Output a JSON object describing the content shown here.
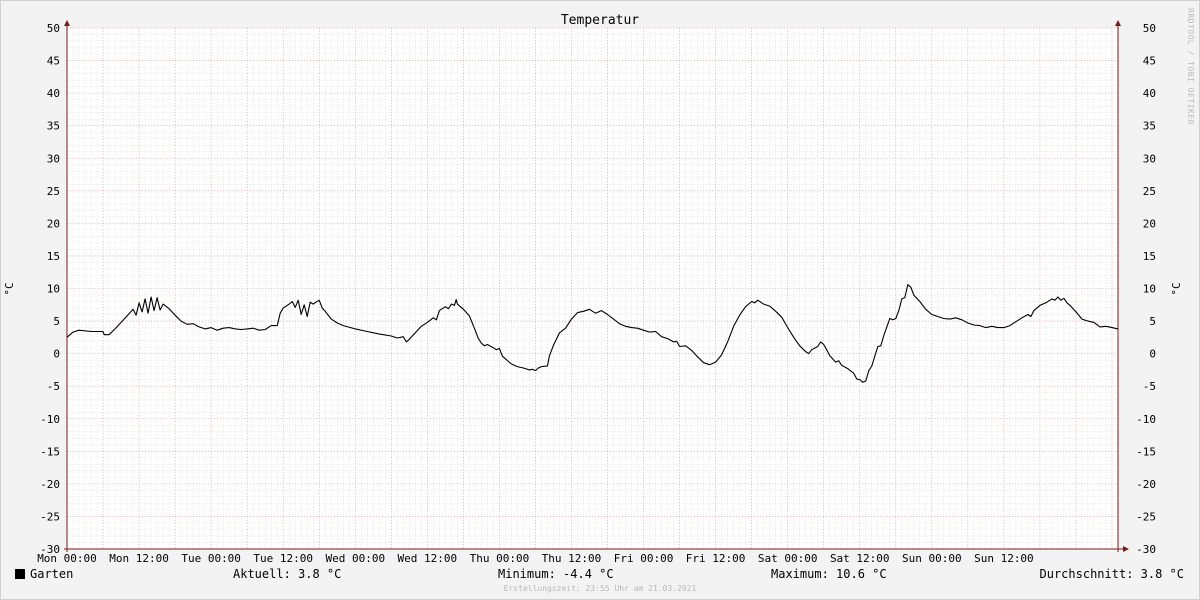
{
  "chart_data": {
    "type": "line",
    "title": "Temperatur",
    "ylabel": "°C",
    "ylabel_right": "°C",
    "ylim": [
      -30,
      50
    ],
    "y_ticks": [
      50,
      45,
      40,
      35,
      30,
      25,
      20,
      15,
      10,
      5,
      0,
      -5,
      -10,
      -15,
      -20,
      -25,
      -30
    ],
    "xlim": [
      0,
      168
    ],
    "x_ticks": [
      {
        "h": 0,
        "label": "Mon 00:00"
      },
      {
        "h": 12,
        "label": "Mon 12:00"
      },
      {
        "h": 24,
        "label": "Tue 00:00"
      },
      {
        "h": 36,
        "label": "Tue 12:00"
      },
      {
        "h": 48,
        "label": "Wed 00:00"
      },
      {
        "h": 60,
        "label": "Wed 12:00"
      },
      {
        "h": 72,
        "label": "Thu 00:00"
      },
      {
        "h": 84,
        "label": "Thu 12:00"
      },
      {
        "h": 96,
        "label": "Fri 00:00"
      },
      {
        "h": 108,
        "label": "Fri 12:00"
      },
      {
        "h": 120,
        "label": "Sat 00:00"
      },
      {
        "h": 132,
        "label": "Sat 12:00"
      },
      {
        "h": 144,
        "label": "Sun 00:00"
      },
      {
        "h": 156,
        "label": "Sun 12:00"
      }
    ],
    "grid": true,
    "series": [
      {
        "name": "Garten",
        "color": "#000000",
        "points": [
          [
            0,
            2.5
          ],
          [
            1,
            3.3
          ],
          [
            2,
            3.6
          ],
          [
            4,
            3.4
          ],
          [
            6,
            3.4
          ],
          [
            6.2,
            2.9
          ],
          [
            7,
            2.9
          ],
          [
            8,
            3.8
          ],
          [
            9,
            4.8
          ],
          [
            10,
            5.8
          ],
          [
            11,
            6.8
          ],
          [
            11.5,
            5.9
          ],
          [
            12,
            7.8
          ],
          [
            12.5,
            6.4
          ],
          [
            13,
            8.4
          ],
          [
            13.5,
            6.2
          ],
          [
            14,
            8.7
          ],
          [
            14.5,
            6.6
          ],
          [
            15,
            8.6
          ],
          [
            15.5,
            6.7
          ],
          [
            16,
            7.6
          ],
          [
            17,
            6.9
          ],
          [
            18,
            5.9
          ],
          [
            19,
            5.0
          ],
          [
            20,
            4.5
          ],
          [
            21,
            4.6
          ],
          [
            22,
            4.1
          ],
          [
            23,
            3.8
          ],
          [
            24,
            4.0
          ],
          [
            25,
            3.6
          ],
          [
            26,
            3.9
          ],
          [
            27,
            4.0
          ],
          [
            28,
            3.8
          ],
          [
            29,
            3.7
          ],
          [
            30,
            3.8
          ],
          [
            31,
            3.9
          ],
          [
            32,
            3.6
          ],
          [
            33,
            3.7
          ],
          [
            34,
            4.3
          ],
          [
            35,
            4.3
          ],
          [
            35.5,
            6.2
          ],
          [
            36,
            7.0
          ],
          [
            37,
            7.6
          ],
          [
            37.5,
            8.0
          ],
          [
            38,
            7.1
          ],
          [
            38.5,
            8.2
          ],
          [
            39,
            6.0
          ],
          [
            39.5,
            7.5
          ],
          [
            40,
            5.7
          ],
          [
            40.5,
            7.9
          ],
          [
            41,
            7.6
          ],
          [
            42,
            8.2
          ],
          [
            42.5,
            7.0
          ],
          [
            43,
            6.5
          ],
          [
            44,
            5.3
          ],
          [
            45,
            4.7
          ],
          [
            46,
            4.3
          ],
          [
            48,
            3.8
          ],
          [
            50,
            3.4
          ],
          [
            52,
            3.0
          ],
          [
            54,
            2.7
          ],
          [
            55,
            2.4
          ],
          [
            56,
            2.6
          ],
          [
            56.5,
            1.8
          ],
          [
            57,
            2.2
          ],
          [
            58,
            3.2
          ],
          [
            59,
            4.2
          ],
          [
            60,
            4.8
          ],
          [
            61,
            5.5
          ],
          [
            61.5,
            5.2
          ],
          [
            62,
            6.6
          ],
          [
            63,
            7.2
          ],
          [
            63.5,
            6.9
          ],
          [
            64,
            7.6
          ],
          [
            64.5,
            7.4
          ],
          [
            64.8,
            8.3
          ],
          [
            65,
            7.6
          ],
          [
            66,
            6.8
          ],
          [
            67,
            5.8
          ],
          [
            68,
            3.5
          ],
          [
            68.5,
            2.3
          ],
          [
            69,
            1.6
          ],
          [
            69.5,
            1.2
          ],
          [
            70,
            1.4
          ],
          [
            71,
            0.9
          ],
          [
            71.5,
            0.6
          ],
          [
            72,
            0.8
          ],
          [
            72.5,
            -0.4
          ],
          [
            73,
            -0.8
          ],
          [
            74,
            -1.6
          ],
          [
            75,
            -2.0
          ],
          [
            76,
            -2.2
          ],
          [
            77,
            -2.5
          ],
          [
            77.5,
            -2.4
          ],
          [
            78,
            -2.6
          ],
          [
            78.5,
            -2.2
          ],
          [
            79,
            -2.0
          ],
          [
            80,
            -1.9
          ],
          [
            80.3,
            -0.4
          ],
          [
            81,
            1.3
          ],
          [
            82,
            3.2
          ],
          [
            83,
            3.9
          ],
          [
            84,
            5.3
          ],
          [
            85,
            6.3
          ],
          [
            86,
            6.5
          ],
          [
            87,
            6.8
          ],
          [
            87.5,
            6.5
          ],
          [
            88,
            6.2
          ],
          [
            89,
            6.6
          ],
          [
            90,
            6.0
          ],
          [
            91,
            5.3
          ],
          [
            92,
            4.6
          ],
          [
            93,
            4.2
          ],
          [
            94,
            4.0
          ],
          [
            95,
            3.9
          ],
          [
            96,
            3.6
          ],
          [
            97,
            3.3
          ],
          [
            98,
            3.4
          ],
          [
            99,
            2.6
          ],
          [
            100,
            2.3
          ],
          [
            101,
            1.8
          ],
          [
            101.5,
            1.9
          ],
          [
            102,
            1.1
          ],
          [
            103,
            1.2
          ],
          [
            104,
            0.5
          ],
          [
            105,
            -0.5
          ],
          [
            106,
            -1.4
          ],
          [
            107,
            -1.7
          ],
          [
            108,
            -1.3
          ],
          [
            109,
            -0.2
          ],
          [
            110,
            1.8
          ],
          [
            111,
            4.2
          ],
          [
            112,
            5.9
          ],
          [
            113,
            7.2
          ],
          [
            114,
            8.0
          ],
          [
            114.5,
            7.8
          ],
          [
            115,
            8.2
          ],
          [
            116,
            7.6
          ],
          [
            117,
            7.3
          ],
          [
            118,
            6.5
          ],
          [
            119,
            5.6
          ],
          [
            120,
            4.0
          ],
          [
            121,
            2.5
          ],
          [
            122,
            1.2
          ],
          [
            123,
            0.3
          ],
          [
            123.5,
            0.0
          ],
          [
            124,
            0.6
          ],
          [
            125,
            1.1
          ],
          [
            125.5,
            1.8
          ],
          [
            126,
            1.4
          ],
          [
            126.5,
            0.6
          ],
          [
            127,
            -0.3
          ],
          [
            128,
            -1.3
          ],
          [
            128.5,
            -1.1
          ],
          [
            129,
            -1.8
          ],
          [
            130,
            -2.3
          ],
          [
            131,
            -3.0
          ],
          [
            131.5,
            -3.9
          ],
          [
            132,
            -4.0
          ],
          [
            132.5,
            -4.4
          ],
          [
            133,
            -4.2
          ],
          [
            133.5,
            -2.6
          ],
          [
            134,
            -1.9
          ],
          [
            135,
            1.1
          ],
          [
            135.5,
            1.2
          ],
          [
            136,
            2.8
          ],
          [
            137,
            5.4
          ],
          [
            137.5,
            5.2
          ],
          [
            138,
            5.4
          ],
          [
            138.5,
            6.6
          ],
          [
            139,
            8.4
          ],
          [
            139.5,
            8.6
          ],
          [
            140,
            10.6
          ],
          [
            140.5,
            10.2
          ],
          [
            141,
            9.0
          ],
          [
            142,
            8.0
          ],
          [
            143,
            6.8
          ],
          [
            144,
            6.0
          ],
          [
            145,
            5.7
          ],
          [
            146,
            5.4
          ],
          [
            147,
            5.3
          ],
          [
            148,
            5.5
          ],
          [
            149,
            5.2
          ],
          [
            150,
            4.7
          ],
          [
            151,
            4.4
          ],
          [
            152,
            4.3
          ],
          [
            153,
            4.0
          ],
          [
            154,
            4.2
          ],
          [
            155,
            4.0
          ],
          [
            156,
            4.0
          ],
          [
            157,
            4.3
          ],
          [
            158,
            4.9
          ],
          [
            159,
            5.5
          ],
          [
            160,
            6.0
          ],
          [
            160.5,
            5.7
          ],
          [
            161,
            6.6
          ],
          [
            162,
            7.4
          ],
          [
            163,
            7.8
          ],
          [
            164,
            8.4
          ],
          [
            164.5,
            8.2
          ],
          [
            165,
            8.7
          ],
          [
            165.5,
            8.2
          ],
          [
            166,
            8.5
          ],
          [
            166.5,
            7.8
          ],
          [
            167,
            7.4
          ],
          [
            168,
            6.4
          ],
          [
            169,
            5.3
          ],
          [
            170,
            5.0
          ],
          [
            171,
            4.8
          ],
          [
            172,
            4.1
          ],
          [
            173,
            4.2
          ],
          [
            174,
            4.0
          ],
          [
            175,
            3.8
          ]
        ]
      }
    ]
  },
  "legend": {
    "series_name": "Garten",
    "aktuell": "Aktuell: 3.8 °C",
    "minimum": "Minimum: -4.4 °C",
    "maximum": "Maximum: 10.6 °C",
    "durchschnitt": "Durchschnitt: 3.8 °C"
  },
  "watermark": "RRDTOOL / TOBI OETIKER",
  "footer": "Erstellungszeit: 23:55 Uhr am 21.03.2021"
}
